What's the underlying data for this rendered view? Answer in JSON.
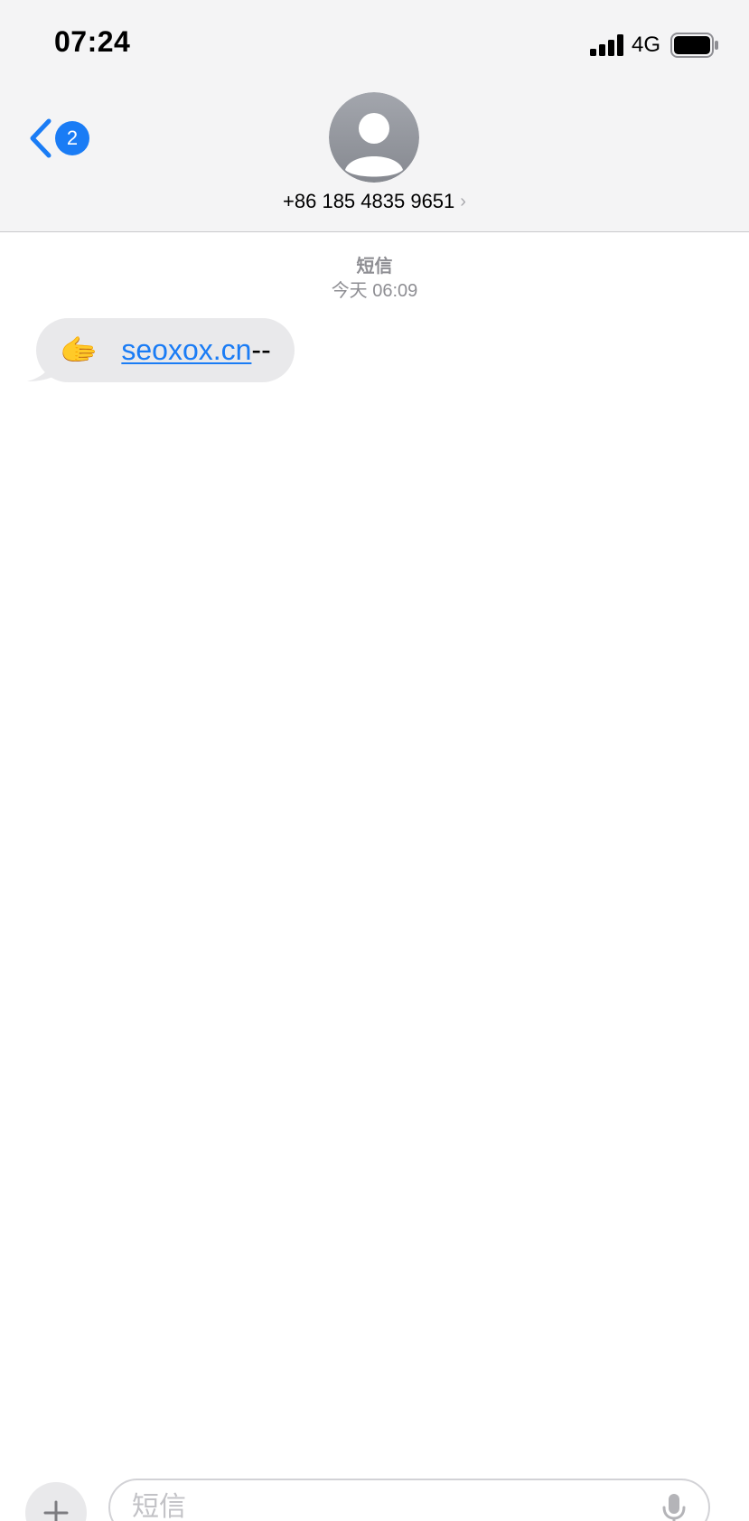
{
  "status_bar": {
    "time": "07:24",
    "network": "4G",
    "signal_icon": "cellular-signal-icon",
    "battery_icon": "battery-icon"
  },
  "nav": {
    "back_icon": "chevron-left-icon",
    "back_badge": "2",
    "avatar_icon": "person-avatar-icon",
    "contact_name": "+86 185 4835 9651",
    "contact_chevron": "›"
  },
  "conversation": {
    "service_label": "短信",
    "timestamp": "今天 06:09",
    "messages": [
      {
        "emoji": "🫱",
        "link_text": "seoxox.cn",
        "trailing_text": "--"
      }
    ]
  },
  "composer": {
    "add_icon": "plus-icon",
    "placeholder": "短信",
    "mic_icon": "microphone-icon"
  },
  "colors": {
    "accent": "#1a7cf5",
    "header_bg": "#f4f4f5",
    "bubble_bg": "#e9e9eb",
    "meta_text": "#8e8e93"
  }
}
